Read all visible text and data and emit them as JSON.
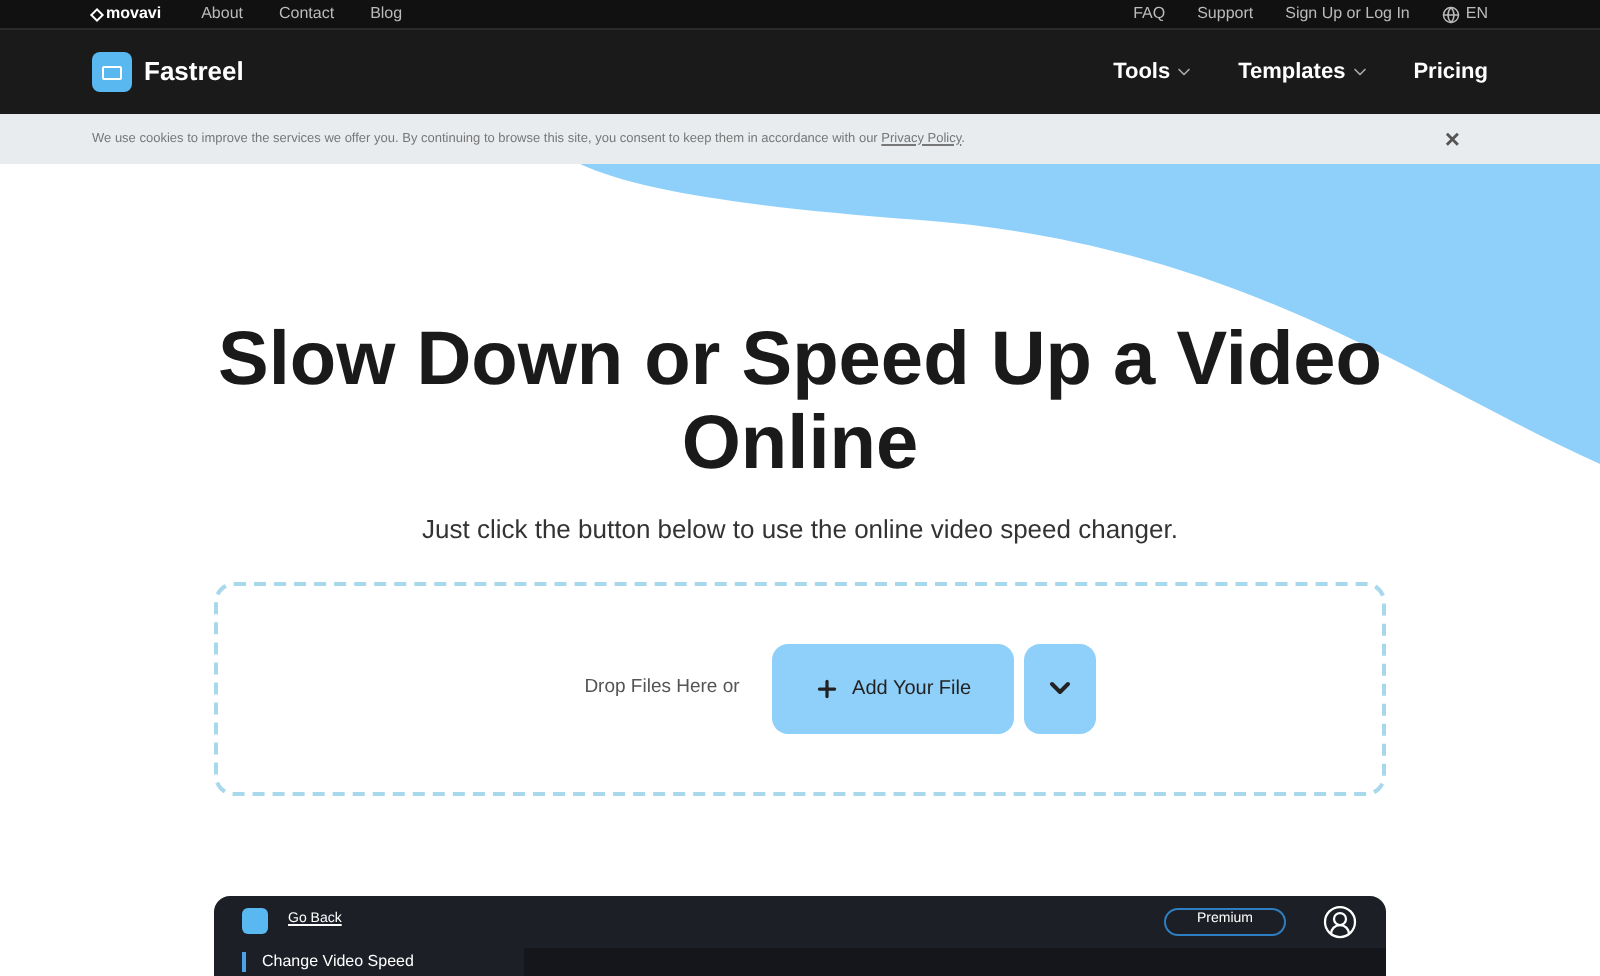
{
  "top_bar": {
    "brand": "movavi",
    "links": [
      "About",
      "Contact",
      "Blog"
    ],
    "right_links": [
      "FAQ",
      "Support",
      "Sign Up or Log In"
    ],
    "language": "EN"
  },
  "nav": {
    "product": "Fastreel",
    "menu": [
      {
        "label": "Tools",
        "dropdown": true
      },
      {
        "label": "Templates",
        "dropdown": true
      },
      {
        "label": "Pricing",
        "dropdown": false
      }
    ]
  },
  "cookie_banner": {
    "text": "We use cookies to improve the services we offer you. By continuing to browse this site, you consent to keep them in accordance with our",
    "link": "Privacy Policy",
    "link_end": ".",
    "close": "×"
  },
  "hero": {
    "title": "Slow Down or Speed Up a Video Online",
    "subtitle": "Just click the button below to use the online video speed changer."
  },
  "upload": {
    "drop_text": "Drop Files Here or",
    "button": "Add Your File"
  },
  "app_preview": {
    "back_link": "Go Back",
    "premium": "Premium",
    "sidebar_item": "Change Video Speed"
  }
}
